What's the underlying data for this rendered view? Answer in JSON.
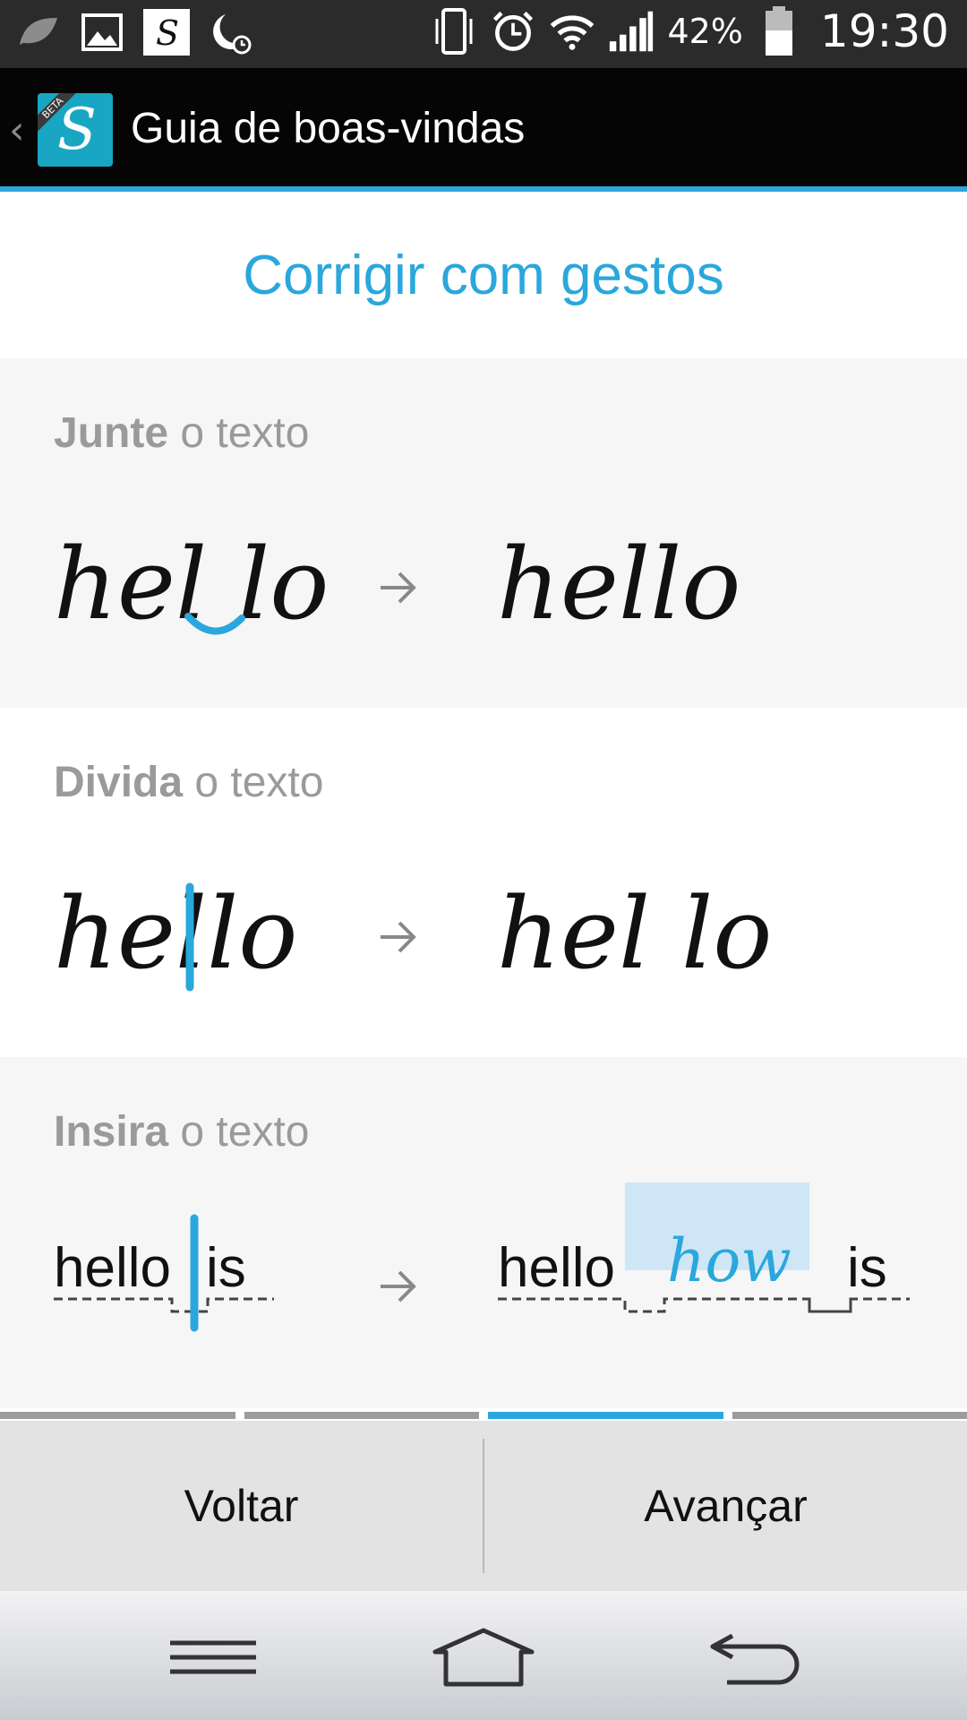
{
  "status_bar": {
    "battery_percent": "42%",
    "time": "19:30",
    "icons_left": [
      "leaf-icon",
      "gallery-icon",
      "stylus-app-icon",
      "night-mode-icon"
    ],
    "icons_right": [
      "vibrate-icon",
      "alarm-icon",
      "wifi-icon",
      "signal-icon",
      "battery-icon"
    ]
  },
  "app_bar": {
    "title": "Guia de boas-vindas",
    "badge": "BETA",
    "logo_letter": "S"
  },
  "page": {
    "heading": "Corrigir com gestos"
  },
  "sections": [
    {
      "verb": "Junte",
      "rest": " o texto",
      "before": "hel lo",
      "after": "hello"
    },
    {
      "verb": "Divida",
      "rest": " o texto",
      "before": "hello",
      "after": "hel lo"
    },
    {
      "verb": "Insira",
      "rest": " o texto",
      "before_1": "hello",
      "before_2": "is",
      "after_1": "hello",
      "after_inserted": "how",
      "after_2": "is"
    }
  ],
  "pager": {
    "count": 4,
    "active_index": 2
  },
  "buttons": {
    "back": "Voltar",
    "next": "Avançar"
  },
  "nav": [
    "menu-icon",
    "home-icon",
    "back-icon"
  ],
  "colors": {
    "accent": "#2aa7dc",
    "appbar": "#050505",
    "statusbar": "#2b2b2b"
  }
}
